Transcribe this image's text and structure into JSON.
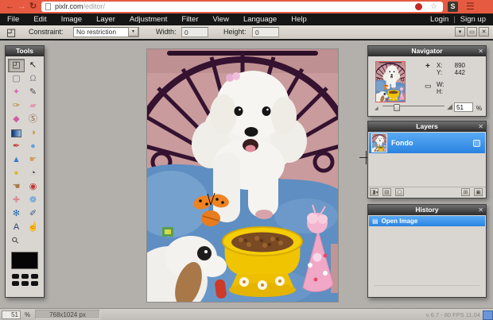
{
  "browser": {
    "url_host": "pixlr.com",
    "url_path": "/editor/",
    "extension_glyph": "S"
  },
  "icons": {
    "back": "←",
    "forward": "→",
    "reload": "↻",
    "star": "☆",
    "menu": "☰",
    "close": "✕",
    "dropdown": "▾",
    "restore": "▭",
    "crop_current": "◰",
    "crosshair": "+",
    "wh_rect": "▭",
    "mountain_small": "◢",
    "mountain_large": "◢",
    "history_item": "▤",
    "layer_settings": "◨",
    "layer_mask": "▤",
    "layer_square": "▢",
    "layer_new": "⊞",
    "layer_delete": "▣"
  },
  "menu": {
    "items": [
      "File",
      "Edit",
      "Image",
      "Layer",
      "Adjustment",
      "Filter",
      "View",
      "Language",
      "Help"
    ],
    "login": "Login",
    "divider": "|",
    "signup": "Sign up"
  },
  "toolbar": {
    "constraint_label": "Constraint:",
    "constraint_value": "No restriction",
    "width_label": "Width:",
    "width_value": "0",
    "height_label": "Height:",
    "height_value": "0"
  },
  "tools": {
    "title": "Tools",
    "items": [
      {
        "name": "crop",
        "glyph": "◰",
        "color": "#222222",
        "selected": true
      },
      {
        "name": "move",
        "glyph": "↖",
        "color": "#1a1a1a"
      },
      {
        "name": "marquee",
        "glyph": "▢",
        "color": "#667788"
      },
      {
        "name": "lasso",
        "glyph": "Ω",
        "color": "#8a8a94"
      },
      {
        "name": "wand",
        "glyph": "✦",
        "color": "#d86ab8"
      },
      {
        "name": "pencil",
        "glyph": "✎",
        "color": "#4a4a52"
      },
      {
        "name": "brush",
        "glyph": "✑",
        "color": "#b87f30"
      },
      {
        "name": "eraser",
        "glyph": "▰",
        "color": "#e09ab0"
      },
      {
        "name": "paint-bucket",
        "glyph": "◆",
        "color": "#cf5fa2"
      },
      {
        "name": "clone-stamp",
        "glyph": "Ⓢ",
        "color": "#7d5f3e"
      },
      {
        "name": "gradient",
        "glyph": "",
        "color": ""
      },
      {
        "name": "color-replace",
        "glyph": "◑",
        "color": "#c7922a"
      },
      {
        "name": "drawing",
        "glyph": "✒",
        "color": "#c04030"
      },
      {
        "name": "blur",
        "glyph": "●",
        "color": "#66a0dd"
      },
      {
        "name": "sharpen",
        "glyph": "▲",
        "color": "#3f7fc4"
      },
      {
        "name": "smudge",
        "glyph": "☛",
        "color": "#d0a060"
      },
      {
        "name": "sponge",
        "glyph": "●",
        "color": "#ddb83a"
      },
      {
        "name": "dodge",
        "glyph": "◔",
        "color": "#33333b"
      },
      {
        "name": "burn",
        "glyph": "☚",
        "color": "#a87848"
      },
      {
        "name": "red-eye",
        "glyph": "◉",
        "color": "#c23a36"
      },
      {
        "name": "spot-heal",
        "glyph": "✚",
        "color": "#d98a96"
      },
      {
        "name": "bloat",
        "glyph": "❁",
        "color": "#4f9ade"
      },
      {
        "name": "pinch",
        "glyph": "✻",
        "color": "#2f6fb2"
      },
      {
        "name": "color-picker",
        "glyph": "✐",
        "color": "#3a5a8c"
      },
      {
        "name": "type",
        "glyph": "A",
        "color": "#27406e"
      },
      {
        "name": "hand",
        "glyph": "☝",
        "color": "#d2a05c"
      },
      {
        "name": "zoom",
        "glyph": "⚲",
        "color": "#3a3a40",
        "rotate": -45
      }
    ]
  },
  "navigator": {
    "title": "Navigator",
    "x_label": "X:",
    "x_value": "890",
    "y_label": "Y:",
    "y_value": "442",
    "w_label": "W:",
    "h_label": "H:",
    "zoom_value": "51",
    "percent_label": "%"
  },
  "layers": {
    "title": "Layers",
    "layer_name": "Fondo"
  },
  "history": {
    "title": "History",
    "item_label": "Open Image"
  },
  "status": {
    "zoom_value": "51",
    "percent_label": "%",
    "dimensions": "768x1024 px",
    "version_text": "v 6.7 - 80 FPS 11.04"
  }
}
